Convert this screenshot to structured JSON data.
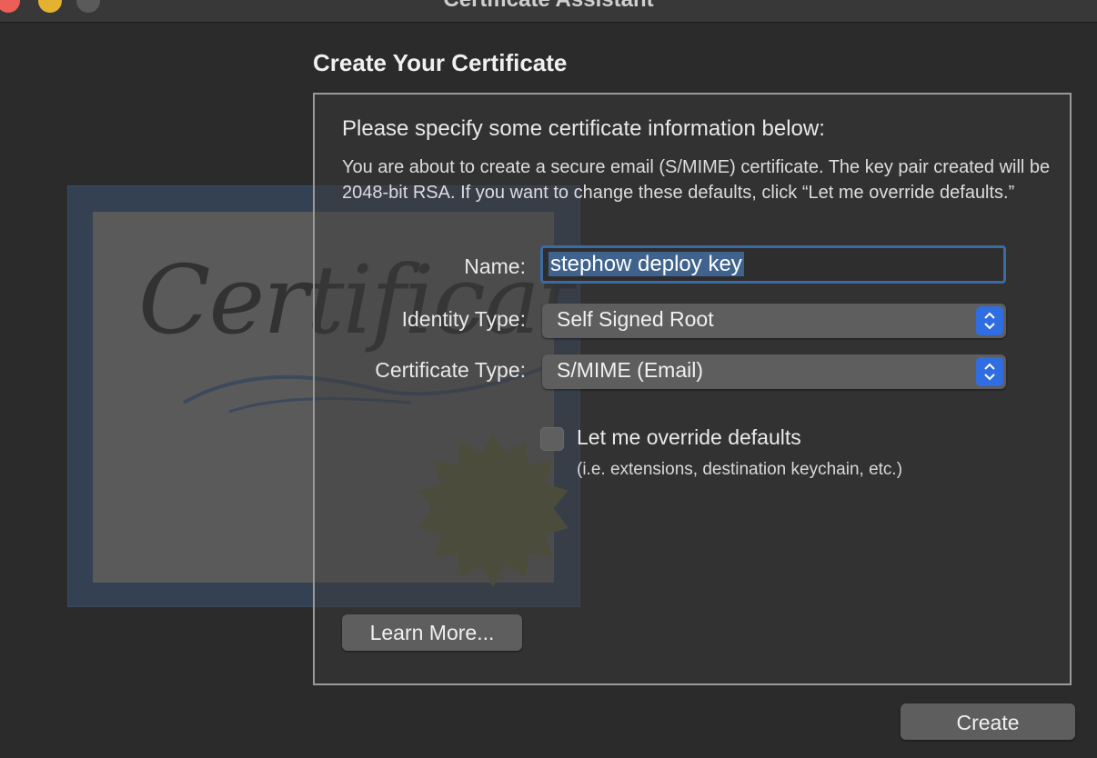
{
  "window": {
    "title": "Certificate Assistant"
  },
  "page": {
    "title": "Create Your Certificate",
    "intro": "Please specify some certificate information below:",
    "description": "You are about to create a secure email (S/MIME) certificate. The key pair created will be 2048-bit RSA. If you want to change these defaults, click “Let me override defaults.”"
  },
  "artwork": {
    "script_text": "Certificate"
  },
  "form": {
    "name_label": "Name:",
    "name_value": "stephow deploy key",
    "identity_type_label": "Identity Type:",
    "identity_type_value": "Self Signed Root",
    "certificate_type_label": "Certificate Type:",
    "certificate_type_value": "S/MIME (Email)",
    "override_label": "Let me override defaults",
    "override_checked": false,
    "override_hint": "(i.e. extensions, destination keychain, etc.)"
  },
  "buttons": {
    "learn_more": "Learn More...",
    "create": "Create"
  },
  "colors": {
    "accent": "#2f6de1",
    "focus_ring": "#3c6aa3",
    "close": "#ec5f57",
    "minimize": "#e2b230"
  }
}
